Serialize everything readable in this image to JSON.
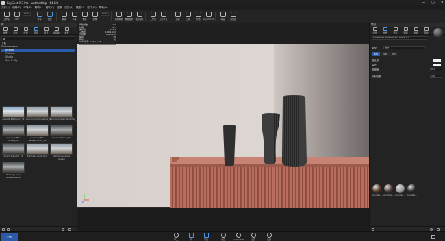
{
  "window": {
    "title": "KeyShot 9.3 Pro - untitled.bip - 64 bit",
    "controls": [
      "—",
      "▢",
      "✕"
    ]
  },
  "menu": [
    "文件(F)",
    "编辑(E)",
    "环境(E)",
    "照明(L)",
    "相机(C)",
    "图像",
    "渲染(R)",
    "视图(V)",
    "窗口(W)",
    "帮助(H)"
  ],
  "toolbar": {
    "items": [
      "工作区",
      "CPU",
      "使用",
      "暂停",
      "性能",
      "翻译",
      "平移",
      "推移",
      "视角",
      "添加相机",
      "重置相机",
      "锁定相机",
      "工作室",
      "几何节点",
      "渲染",
      "工具",
      "开始",
      "KeyShotXR",
      "动画",
      "渲染区"
    ],
    "dropdown": "50.0"
  },
  "library": {
    "header": "库",
    "tabs": [
      "材质",
      "颜色",
      "纹理",
      "环境",
      "背景",
      "收藏夹",
      "模型"
    ],
    "tree": [
      "下载",
      "Environments",
      "Interior",
      "Outdoor",
      "Studio",
      "Sun & Sky"
    ],
    "thumbnails": [
      "Aversis_Bathroom_3k",
      "Aversis_Clothingstore_3k",
      "Aversis_Industrialkitchen_3k",
      "Aversis_Office hallway_4k",
      "Aversis_Office hallway white_3k",
      "Dosch-Kitchen_3k",
      "Dosch-Trainstill_2k",
      "Italmago cyclorama",
      "Italmago enigma modern",
      "Italmago slow storehouse 4k"
    ]
  },
  "hud": {
    "rows": [
      [
        "每秒帧数",
        "1.1"
      ],
      [
        "时间",
        "4.7"
      ],
      [
        "采样数",
        "2k+1"
      ],
      [
        "三角形",
        "1,005,140"
      ],
      [
        "分辨率",
        "980×540"
      ],
      [
        "焦距",
        "35"
      ],
      [
        "降噪",
        "关"
      ]
    ],
    "footer": "GPU 内存: 1.55 / 6 GB"
  },
  "properties": {
    "header": "项目",
    "tabs": [
      "场景",
      "材质",
      "环境",
      "照明",
      "相机",
      "图像"
    ],
    "material_name": "Aluminum Brushed 45° Black #2",
    "type_label": "类型:",
    "type_value": "油漆",
    "subtabs": [
      "属性",
      "纹理",
      "标签"
    ],
    "fields": [
      {
        "label": "漫反射",
        "value": ""
      },
      {
        "label": "高光",
        "value": ""
      },
      {
        "label": "粗糙度",
        "value": "0.1"
      },
      {
        "label": "折射指数",
        "value": "1.5"
      }
    ],
    "colors": {
      "diffuse": "#f4f4f4",
      "specular": "#f4f4f4"
    },
    "materials": [
      {
        "label": "Anodize...",
        "color": "#5a3a2a"
      },
      {
        "label": "Anodize...",
        "color": "#4a3a34"
      },
      {
        "label": "Anodize...",
        "color": "#9a9a9a"
      },
      {
        "label": "Anodize...",
        "color": "#2a2a2a"
      }
    ]
  },
  "bottombar": {
    "left": "工作区",
    "items": [
      "导入",
      "库",
      "项目",
      "动画",
      "KeyShotXR",
      "渲染",
      "截屏"
    ]
  }
}
